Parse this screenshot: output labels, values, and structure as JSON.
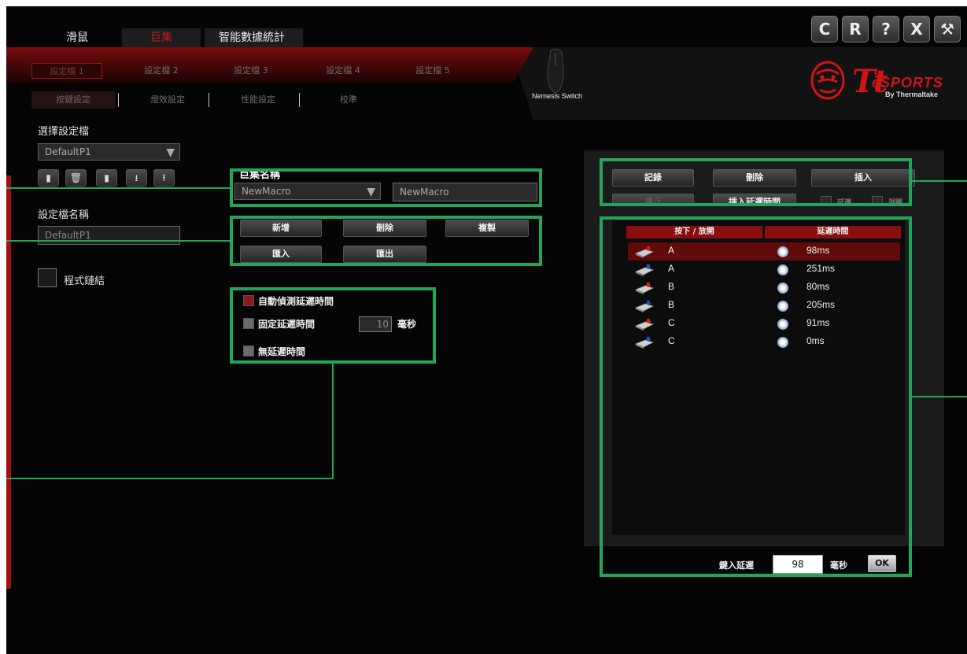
{
  "main_tabs": {
    "mouse": "滑鼠",
    "macro": "巨集",
    "stats": "智能數據統計"
  },
  "profile_tabs": [
    "設定檔 1",
    "設定檔 2",
    "設定檔 3",
    "設定檔 4",
    "設定檔 5"
  ],
  "sub_tabs": [
    "按鍵設定",
    "燈效設定",
    "性能設定",
    "校準"
  ],
  "window_buttons": [
    "C",
    "R",
    "?",
    "X",
    "⚒"
  ],
  "brand": {
    "tt": "Tt",
    "esports": "eSPORTS",
    "by": "By Thermaltake",
    "device": "Nemesis Switch"
  },
  "left": {
    "select_profile_label": "選擇設定檔",
    "select_profile_value": "DefaultP1",
    "profile_name_label": "設定檔名稱",
    "profile_name_value": "DefaultP1",
    "program_link_label": "程式鏈結"
  },
  "macro": {
    "name_label": "巨集名稱",
    "select_value": "NewMacro",
    "name_value": "NewMacro",
    "buttons": {
      "add": "新增",
      "delete": "刪除",
      "copy": "複製",
      "import": "匯入",
      "export": "匯出"
    },
    "options": {
      "auto": "自動偵測延遲時間",
      "fixed": "固定延遲時間",
      "fixed_value": "10",
      "fixed_unit": "毫秒",
      "none": "無延遲時間"
    }
  },
  "record": {
    "record": "記錄",
    "delete": "刪除",
    "insert": "插入",
    "stop": "停止",
    "delay_toggle": "插入延遲時間",
    "opt1": "延遲",
    "opt2": "迴圈"
  },
  "table": {
    "headers": [
      "按下 / 放開",
      "延遲時間"
    ],
    "rows": [
      {
        "key": "A",
        "delay": "98ms",
        "action": "press"
      },
      {
        "key": "A",
        "delay": "251ms",
        "action": "release"
      },
      {
        "key": "B",
        "delay": "80ms",
        "action": "press"
      },
      {
        "key": "B",
        "delay": "205ms",
        "action": "release"
      },
      {
        "key": "C",
        "delay": "91ms",
        "action": "press"
      },
      {
        "key": "C",
        "delay": "0ms",
        "action": "release"
      }
    ]
  },
  "bottom": {
    "label": "鍵入延遲",
    "value": "98",
    "unit": "毫秒",
    "ok": "OK"
  },
  "colors": {
    "accent": "#c21a1a",
    "annotation": "#22a55a"
  }
}
